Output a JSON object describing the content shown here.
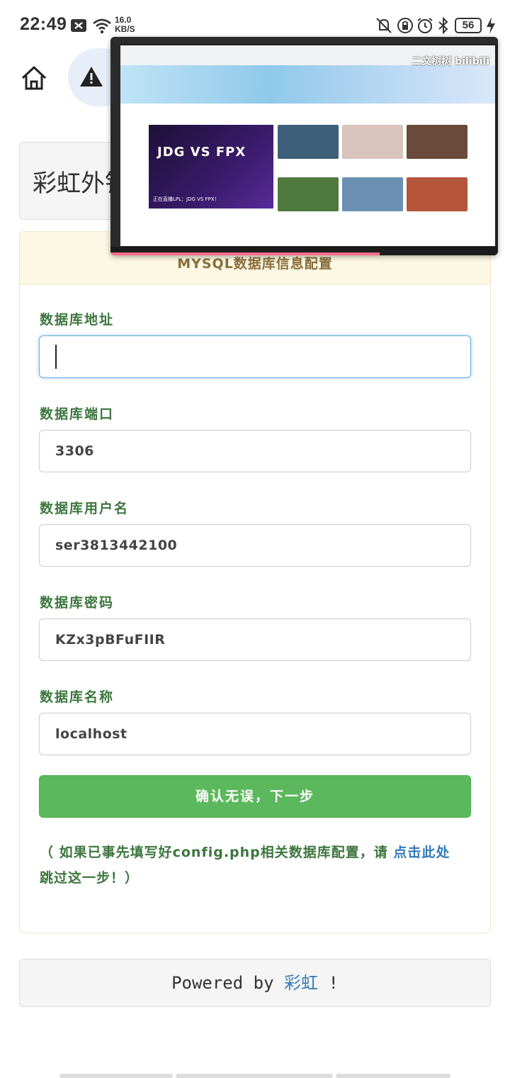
{
  "status_bar": {
    "time": "22:49",
    "net_speed_value": "16.0",
    "net_speed_unit": "KB/S",
    "battery": "56"
  },
  "title_box": {
    "title": "彩虹外铁"
  },
  "panel": {
    "heading": "MYSQL数据库信息配置",
    "fields": [
      {
        "label": "数据库地址",
        "value": ""
      },
      {
        "label": "数据库端口",
        "value": "3306"
      },
      {
        "label": "数据库用户名",
        "value": "ser3813442100"
      },
      {
        "label": "数据库密码",
        "value": "KZx3pBFuFIIR"
      },
      {
        "label": "数据库名称",
        "value": "localhost"
      }
    ],
    "submit_label": "确认无误，下一步",
    "note_prefix": "（ 如果已事先填写好config.php相关数据库配置，请 ",
    "note_link": "点击此处",
    "note_suffix": "跳过这一步！）"
  },
  "footer": {
    "prefix": "Powered by ",
    "brand": "彩虹",
    "suffix": " !"
  },
  "floating_window": {
    "watermark": "二文树树 bilibili",
    "promo_vs": "JDG VS FPX",
    "promo_caption": "正在直播LPL：JDG VS FPX！"
  },
  "colors": {
    "success": "#5cb85c",
    "label_green": "#3c763d",
    "link_blue": "#337ab7",
    "panel_head": "#fcf8e3"
  }
}
